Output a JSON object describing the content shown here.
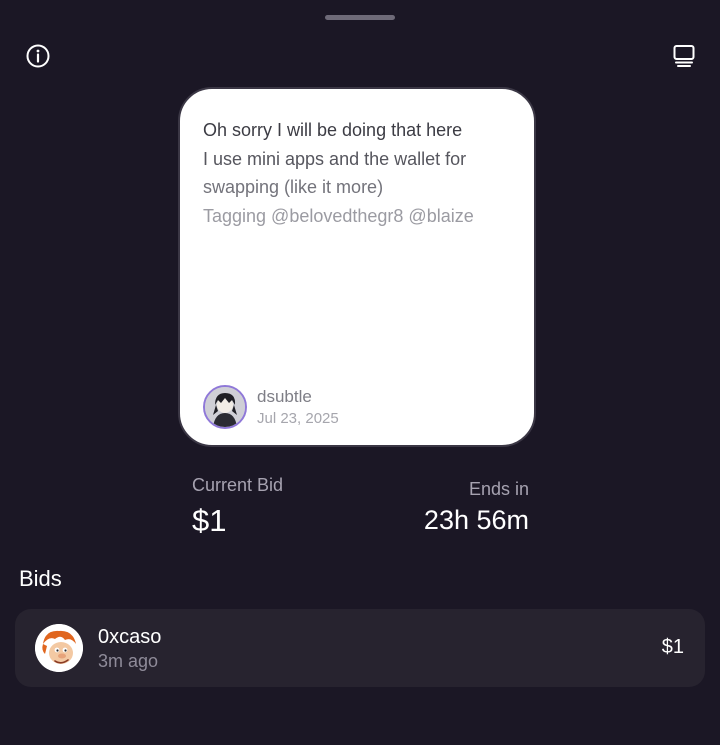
{
  "header": {
    "info_icon": "info-icon",
    "display_icon": "display-icon"
  },
  "cast": {
    "lines": [
      "Oh sorry I will be doing that here",
      "I use mini apps and the wallet for",
      "swapping (like it more)",
      "Tagging @belovedthegr8 @blaize"
    ],
    "author": "dsubtle",
    "date": "Jul 23, 2025"
  },
  "auction": {
    "current_bid_label": "Current Bid",
    "current_bid_value": "$1",
    "ends_label": "Ends in",
    "ends_value": "23h 56m"
  },
  "bids": {
    "title": "Bids",
    "items": [
      {
        "name": "0xcaso",
        "time": "3m ago",
        "amount": "$1"
      }
    ]
  },
  "colors": {
    "background": "#1b1725",
    "card": "#ffffff",
    "row": "#27232f",
    "avatar_ring": "#8f78d8"
  }
}
